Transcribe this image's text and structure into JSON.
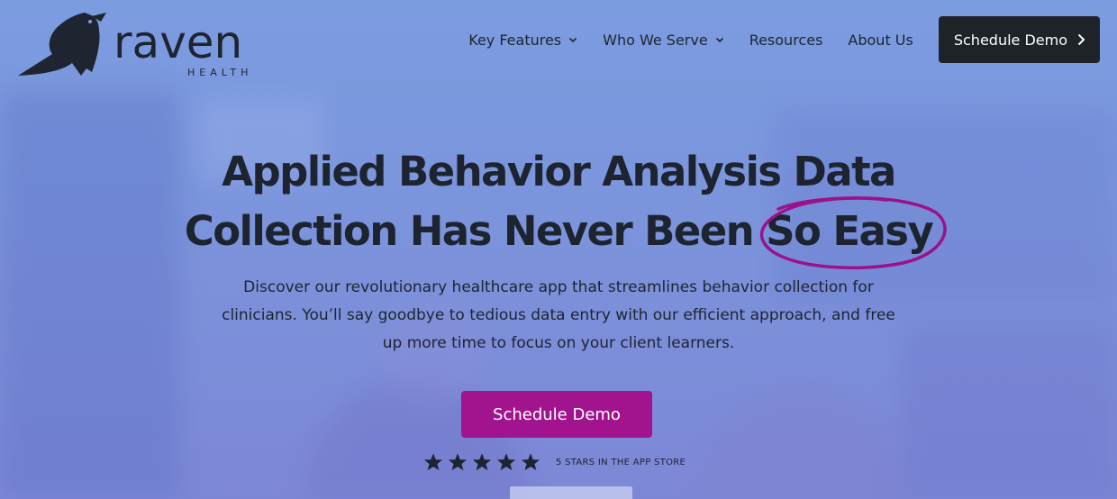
{
  "brand": {
    "name": "raven",
    "subtitle": "HEALTH"
  },
  "nav": {
    "items": [
      {
        "label": "Key Features",
        "has_dropdown": true,
        "icon": "chevron-down-icon"
      },
      {
        "label": "Who We Serve",
        "has_dropdown": true,
        "icon": "chevron-down-icon"
      },
      {
        "label": "Resources",
        "has_dropdown": false
      },
      {
        "label": "About Us",
        "has_dropdown": false
      }
    ],
    "cta_label": "Schedule Demo",
    "cta_icon": "chevron-right-icon"
  },
  "hero": {
    "title_line1": "Applied Behavior Analysis Data",
    "title_line2_prefix": "Collection Has Never Been ",
    "title_highlight": "So Easy",
    "description": "Discover our revolutionary healthcare app that streamlines behavior collection for clinicians. You’ll say goodbye to tedious data entry with our efficient approach, and free up more time to focus on your client learners.",
    "cta_label": "Schedule Demo",
    "rating": {
      "stars": 5,
      "max": 5,
      "caption": "5 STARS IN THE APP STORE"
    }
  },
  "colors": {
    "accent": "#a1148e",
    "dark_button": "#1e2327",
    "text": "#1d2430",
    "background": "#7c94dc"
  }
}
